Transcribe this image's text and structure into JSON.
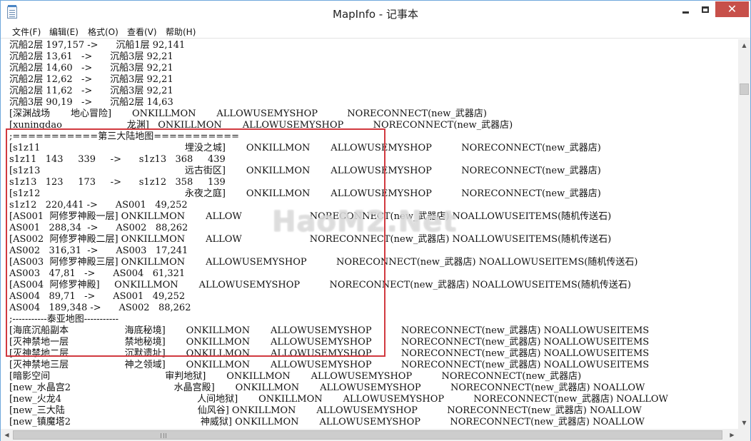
{
  "window": {
    "title": "MapInfo - 记事本"
  },
  "controls": {
    "minimize": "minimize",
    "maximize": "maximize",
    "close": "✕"
  },
  "menu": [
    "文件(F)",
    "编辑(E)",
    "格式(O)",
    "查看(V)",
    "帮助(H)"
  ],
  "lines": [
    "沉船2层 197,157 ->      沉船1层 92,141",
    "沉船2层 13,61   ->      沉船3层 92,21",
    "沉船2层 14,60   ->      沉船3层 92,21",
    "沉船2层 12,62   ->      沉船3层 92,21",
    "沉船2层 11,62   ->      沉船3层 92,21",
    "沉船3层 90,19   ->      沉船2层 14,63",
    "[深渊战场       地心冒险]       ONKILLMON       ALLOWUSEMYSHOP          NORECONNECT(new_武器店)",
    "[xuningdao                      龙渊]   ONKILLMON       ALLOWUSEMYSHOP          NORECONNECT(new_武器店)",
    ";===========第三大陆地图===========",
    "[s1z11                                                 埋没之城]       ONKILLMON       ALLOWUSEMYSHOP          NORECONNECT(new_武器店)",
    "s1z11   143     339     ->      s1z13   368     439",
    "[s1z13                                                 远古街区]       ONKILLMON       ALLOWUSEMYSHOP          NORECONNECT(new_武器店)",
    "s1z13   123     173     ->      s1z12   358     139",
    "[s1z12                                                 永夜之庭]       ONKILLMON       ALLOWUSEMYSHOP          NORECONNECT(new_武器店)",
    "s1z12   220,441 ->      AS001   49,252",
    "[AS001  阿修罗神殿一层] ONKILLMON       ALLOW                       NORECONNECT(new_武器店) NOALLOWUSEITEMS(随机传送石)",
    "AS001   288,34  ->      AS002   88,262",
    "[AS002  阿修罗神殿二层] ONKILLMON       ALLOW                       NORECONNECT(new_武器店) NOALLOWUSEITEMS(随机传送石)",
    "AS002   316,31  ->      AS003   17,241",
    "[AS003  阿修罗神殿三层] ONKILLMON       ALLOWUSEMYSHOP          NORECONNECT(new_武器店) NOALLOWUSEITEMS(随机传送石)",
    "AS003   47,81   ->      AS004   61,321",
    "[AS004  阿修罗神殿]     ONKILLMON       ALLOWUSEMYSHOP          NORECONNECT(new_武器店) NOALLOWUSEITEMS(随机传送石)",
    "AS004   89,71   ->      AS001   49,252",
    "AS004   189,348 ->      AS002   88,262",
    ";-----------泰亚地图-----------",
    "[海底沉船副本                   海底秘境]       ONKILLMON       ALLOWUSEMYSHOP          NORECONNECT(new_武器店) NOALLOWUSEITEMS",
    "[灭神禁地一层                   禁地秘境]       ONKILLMON       ALLOWUSEMYSHOP          NORECONNECT(new_武器店) NOALLOWUSEITEMS",
    "[灭神禁地二层                   沉默遗址]       ONKILLMON       ALLOWUSEMYSHOP          NORECONNECT(new_武器店) NOALLOWUSEITEMS",
    "[灭神禁地三层                   神之领域]       ONKILLMON       ALLOWUSEMYSHOP          NORECONNECT(new_武器店) NOALLOWUSEITEMS",
    "[暗影空间                                       审判地狱]       ONKILLMON       ALLOWUSEMYSHOP          NORECONNECT(new_武器店)",
    "[new_水晶宫2                                   水晶宫殿]       ONKILLMON       ALLOWUSEMYSHOP          NORECONNECT(new_武器店) NOALLOW",
    "[new_火龙4                                              人间地狱]       ONKILLMON       ALLOWUSEMYSHOP          NORECONNECT(new_武器店) NOALLOW",
    "[new_三大陆                                             仙风谷] ONKILLMON       ALLOWUSEMYSHOP          NORECONNECT(new_武器店) NOALLOW",
    "[new_镇魔塔2                                            神威狱] ONKILLMON       ALLOWUSEMYSHOP          NORECONNECT(new_武器店) NOALLOW"
  ],
  "watermark": "HaoM2.Net",
  "scroll": {
    "up": "▲",
    "down": "▼",
    "left": "◀",
    "right": "▶"
  }
}
